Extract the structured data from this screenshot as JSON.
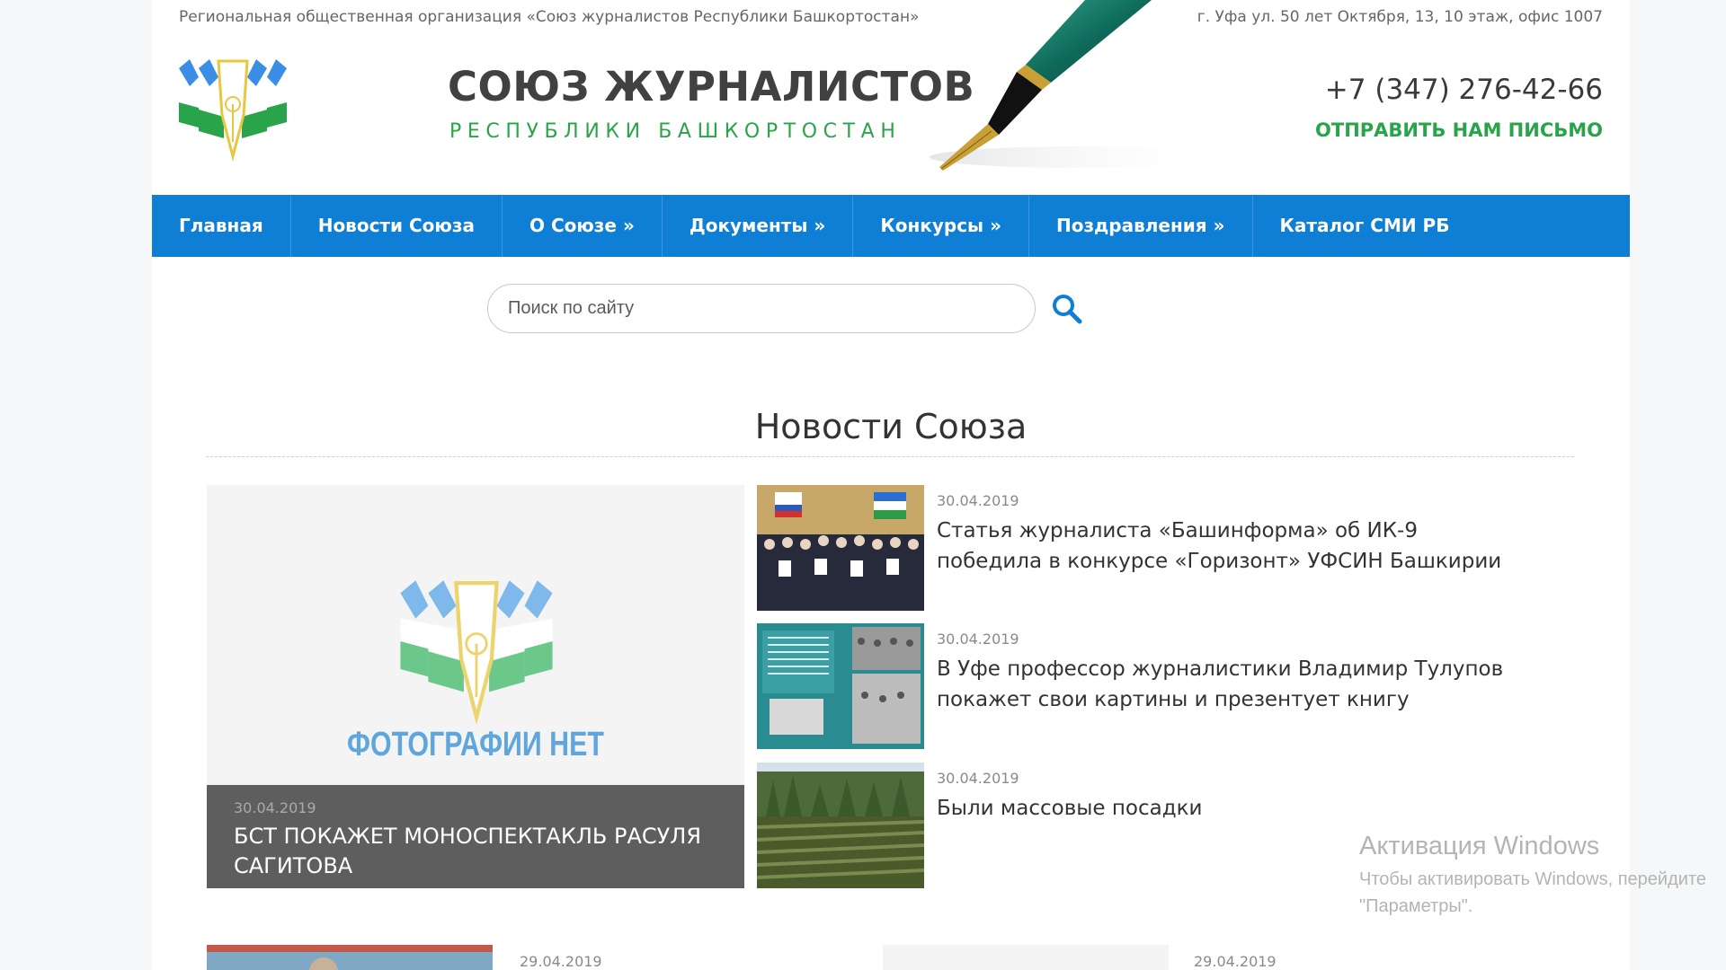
{
  "header": {
    "org_name": "Региональная общественная организация «Союз журналистов Республики Башкортостан»",
    "address": "г. Уфа ул. 50 лет Октября, 13, 10 этаж, офис 1007",
    "title": "СОЮЗ ЖУРНАЛИСТОВ",
    "subtitle": "РЕСПУБЛИКИ БАШКОРТОСТАН",
    "phone": "+7 (347) 276-42-66",
    "send_letter": "ОТПРАВИТЬ НАМ ПИСЬМО"
  },
  "colors": {
    "nav_bg": "#0f7fd6",
    "brand_green": "#2aa44a",
    "logo_blue": "#3a8ee6",
    "caption_bg": "#5e5e5e"
  },
  "nav": {
    "items": [
      {
        "label": "Главная"
      },
      {
        "label": "Новости Союза"
      },
      {
        "label": "О Союзе »"
      },
      {
        "label": "Документы »"
      },
      {
        "label": "Конкурсы »"
      },
      {
        "label": "Поздравления »"
      },
      {
        "label": "Каталог СМИ РБ"
      }
    ]
  },
  "search": {
    "placeholder": "Поиск по сайту",
    "icon": "search-icon"
  },
  "news_section": {
    "title": "Новости Союза",
    "featured": {
      "no_photo_label": "ФОТОГРАФИИ НЕТ",
      "date": "30.04.2019",
      "title": "БСТ покажет моноспектакль Расуля Сагитова"
    },
    "items": [
      {
        "date": "30.04.2019",
        "title": "Статья журналиста «Башинформа» об ИК-9 победила в конкурсе «Горизонт» УФСИН Башкирии"
      },
      {
        "date": "30.04.2019",
        "title": "В Уфе профессор журналистики Владимир Тулупов покажет свои картины и презентует книгу"
      },
      {
        "date": "30.04.2019",
        "title": "Были массовые посадки"
      }
    ],
    "bottom_items": [
      {
        "date": "29.04.2019"
      },
      {
        "date": "29.04.2019"
      }
    ]
  },
  "windows_watermark": {
    "title": "Активация Windows",
    "line1": "Чтобы активировать Windows, перейдите",
    "line2": "\"Параметры\"."
  }
}
